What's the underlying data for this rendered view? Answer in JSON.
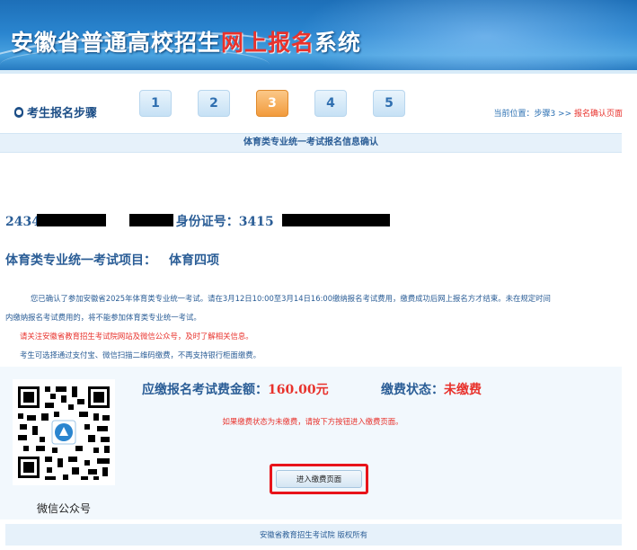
{
  "banner": {
    "title_part1": "安徽省普通高校招生",
    "title_highlight": "网上报名",
    "title_part2": "系统"
  },
  "steps": {
    "label": "考生报名步骤",
    "items": [
      {
        "label": "1",
        "active": false
      },
      {
        "label": "2",
        "active": false
      },
      {
        "label": "3",
        "active": true
      },
      {
        "label": "4",
        "active": false
      },
      {
        "label": "5",
        "active": false
      }
    ],
    "breadcrumb_prefix": "当前位置：步骤3 >> ",
    "breadcrumb_current": "报名确认页面"
  },
  "section_header": "体育类专业统一考试报名信息确认",
  "candidate": {
    "number_prefix": "2434",
    "id_label": "身份证号：3415"
  },
  "exam": {
    "label": "体育类专业统一考试项目：",
    "value": "体育四项"
  },
  "notice": {
    "line1": "您已确认了参加安徽省2025年体育类专业统一考试。请在3月12日10:00至3月14日16:00缴纳报名考试费用，缴费成功后网上报名方才结束。未在规定时间",
    "line2": "内缴纳报名考试费用的，将不能参加体育类专业统一考试。",
    "line3": "请关注安徽省教育招生考试院网站及微信公众号，及时了解相关信息。",
    "line4": "考生可选择通过支付宝、微信扫描二维码缴费，不再支持银行柜面缴费。"
  },
  "payment": {
    "fee_label": "应缴报名考试费金额：",
    "fee_amount": "160.00元",
    "status_label": "缴费状态：",
    "status_value": "未缴费",
    "hint": "如果缴费状态为未缴费，请按下方按钮进入缴费页面。",
    "button_label": "进入缴费页面",
    "qr_caption": "微信公众号"
  },
  "footer": "安徽省教育招生考试院 版权所有",
  "colors": {
    "primary_blue": "#2a5d96",
    "accent_red": "#e8322c",
    "active_step": "#f29b3d"
  }
}
